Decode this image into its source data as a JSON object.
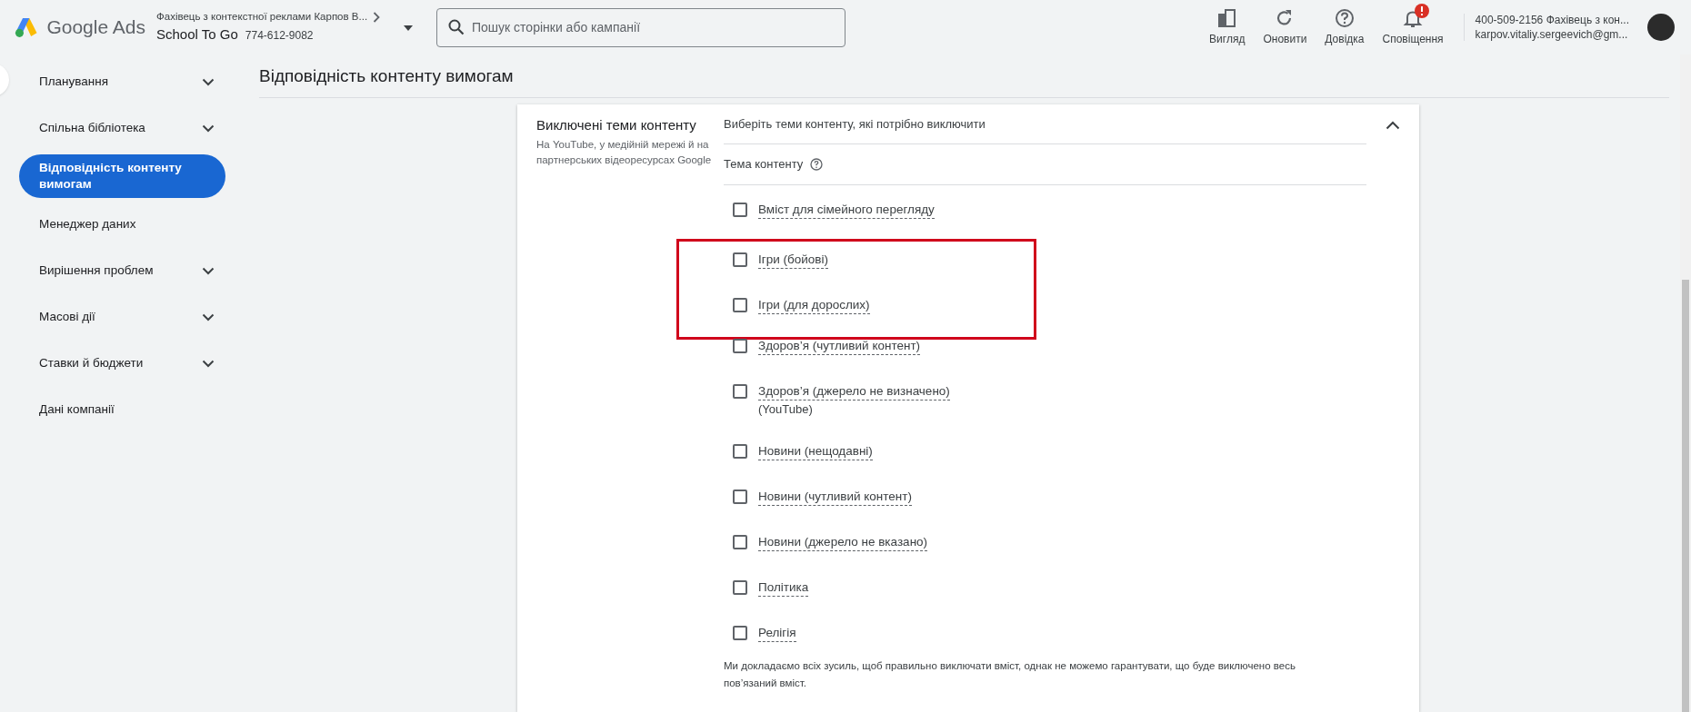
{
  "header": {
    "product": "Google Ads",
    "account": {
      "manager": "Фахівець з контекстної реклами Карпов В...",
      "name": "School To Go",
      "id": "774-612-9082"
    },
    "search": {
      "placeholder": "Пошук сторінки або кампанії"
    },
    "actions": [
      {
        "kind": "view",
        "label": "Вигляд",
        "alert": false
      },
      {
        "kind": "refresh",
        "label": "Оновити",
        "alert": false
      },
      {
        "kind": "help",
        "label": "Довідка",
        "alert": false
      },
      {
        "kind": "bell",
        "label": "Сповіщення",
        "alert": true
      }
    ],
    "user": {
      "line1": "400-509-2156 Фахівець з кон...",
      "line2": "karpov.vitaliy.sergeevich@gm..."
    }
  },
  "sidebar": {
    "items": [
      {
        "label": "Планування",
        "expandable": true,
        "selected": false
      },
      {
        "label": "Спільна бібліотека",
        "expandable": true,
        "selected": false
      },
      {
        "label": "Відповідність контенту вимогам",
        "expandable": false,
        "selected": true
      },
      {
        "label": "Менеджер даних",
        "expandable": false,
        "selected": false
      },
      {
        "label": "Вирішення проблем",
        "expandable": true,
        "selected": false
      },
      {
        "label": "Масові дії",
        "expandable": true,
        "selected": false
      },
      {
        "label": "Ставки й бюджети",
        "expandable": true,
        "selected": false
      },
      {
        "label": "Дані компанії",
        "expandable": false,
        "selected": false
      }
    ]
  },
  "page_title": "Відповідність контенту вимогам",
  "card": {
    "title": "Виключені теми контенту",
    "subtitle": "На YouTube, у медійній мережі й на партнерських відеоресурсах Google",
    "expanded": true,
    "prompt": "Виберіть теми контенту, які потрібно виключити",
    "column": "Тема контенту",
    "topics": [
      {
        "label": "Вміст для сімейного перегляду",
        "checked": false,
        "highlighted": false
      },
      {
        "label": "Ігри (бойові)",
        "checked": false,
        "highlighted": true
      },
      {
        "label": "Ігри (для дорослих)",
        "checked": false,
        "highlighted": true
      },
      {
        "label": "Здоров’я (чутливий контент)",
        "checked": false,
        "highlighted": false
      },
      {
        "label": "Здоров’я (джерело не визначено)",
        "note": "(YouTube)",
        "checked": false,
        "highlighted": false
      },
      {
        "label": "Новини (нещодавні)",
        "checked": false,
        "highlighted": false
      },
      {
        "label": "Новини (чутливий контент)",
        "checked": false,
        "highlighted": false
      },
      {
        "label": "Новини (джерело не вказано)",
        "checked": false,
        "highlighted": false
      },
      {
        "label": "Політика",
        "checked": false,
        "highlighted": false
      },
      {
        "label": "Релігія",
        "checked": false,
        "highlighted": false
      }
    ],
    "disclaimer": "Ми докладаємо всіх зусиль, щоб правильно виключати вміст, однак не можемо гарантувати, що буде виключено весь пов’язаний вміст."
  }
}
